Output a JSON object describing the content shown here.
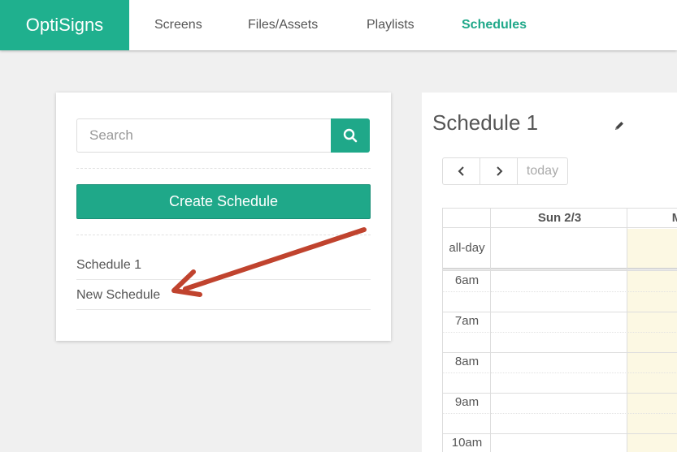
{
  "nav": {
    "brand": "OptiSigns",
    "items": [
      {
        "label": "Screens"
      },
      {
        "label": "Files/Assets"
      },
      {
        "label": "Playlists"
      },
      {
        "label": "Schedules",
        "active": true
      }
    ]
  },
  "sidebar": {
    "search_placeholder": "Search",
    "create_label": "Create Schedule",
    "schedules": [
      {
        "label": "Schedule 1"
      },
      {
        "label": "New Schedule"
      }
    ]
  },
  "calendar": {
    "title": "Schedule 1",
    "today_label": "today",
    "columns": [
      "Sun 2/3",
      "M"
    ],
    "allday_label": "all-day",
    "times": [
      "6am",
      "7am",
      "8am",
      "9am",
      "10am"
    ]
  },
  "colors": {
    "brand": "#1fb08e",
    "accent": "#1fa889",
    "today_highlight": "#fcf8e3",
    "annotation_arrow": "#c0432e"
  },
  "icons": {
    "search": "magnifier-icon",
    "edit": "pencil-icon",
    "prev": "chevron-left-icon",
    "next": "chevron-right-icon"
  }
}
